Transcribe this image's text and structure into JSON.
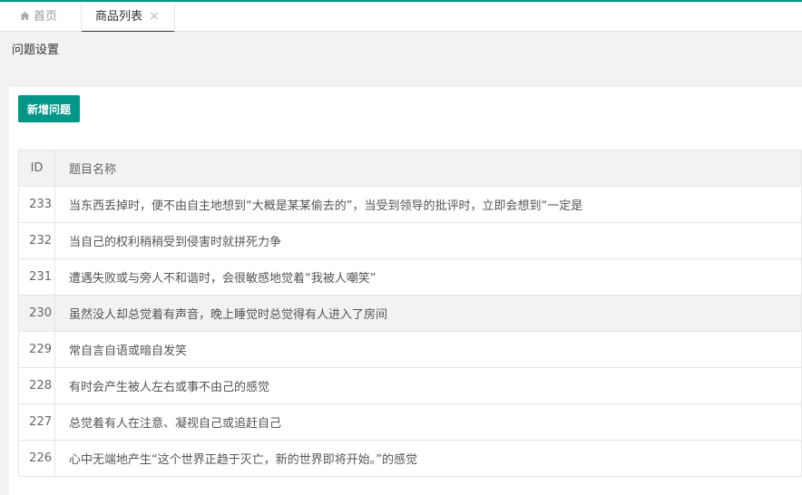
{
  "tabs": {
    "home_label": "首页",
    "active_label": "商品列表",
    "close_glyph": "×"
  },
  "page": {
    "title": "问题设置"
  },
  "toolbar": {
    "add_button_label": "新增问题"
  },
  "table": {
    "headers": {
      "id": "ID",
      "name": "题目名称"
    },
    "rows": [
      {
        "id": "233",
        "name": "当东西丢掉时，便不由自主地想到“大概是某某偷去的”，当受到领导的批评时，立即会想到“一定是"
      },
      {
        "id": "232",
        "name": "当自己的权利稍稍受到侵害时就拼死力争"
      },
      {
        "id": "231",
        "name": "遭遇失败或与旁人不和谐时，会很敏感地觉着“我被人嘲笑”"
      },
      {
        "id": "230",
        "name": "虽然没人却总觉着有声音，晚上睡觉时总觉得有人进入了房间"
      },
      {
        "id": "229",
        "name": "常自言自语或暗自发笑"
      },
      {
        "id": "228",
        "name": "有时会产生被人左右或事不由己的感觉"
      },
      {
        "id": "227",
        "name": "总觉着有人在注意、凝视自己或追赶自己"
      },
      {
        "id": "226",
        "name": "心中无端地产生“这个世界正趋于灭亡，新的世界即将开始。”的感觉"
      }
    ]
  },
  "colors": {
    "accent": "#009688",
    "hover_row": "#f2f2f2"
  }
}
